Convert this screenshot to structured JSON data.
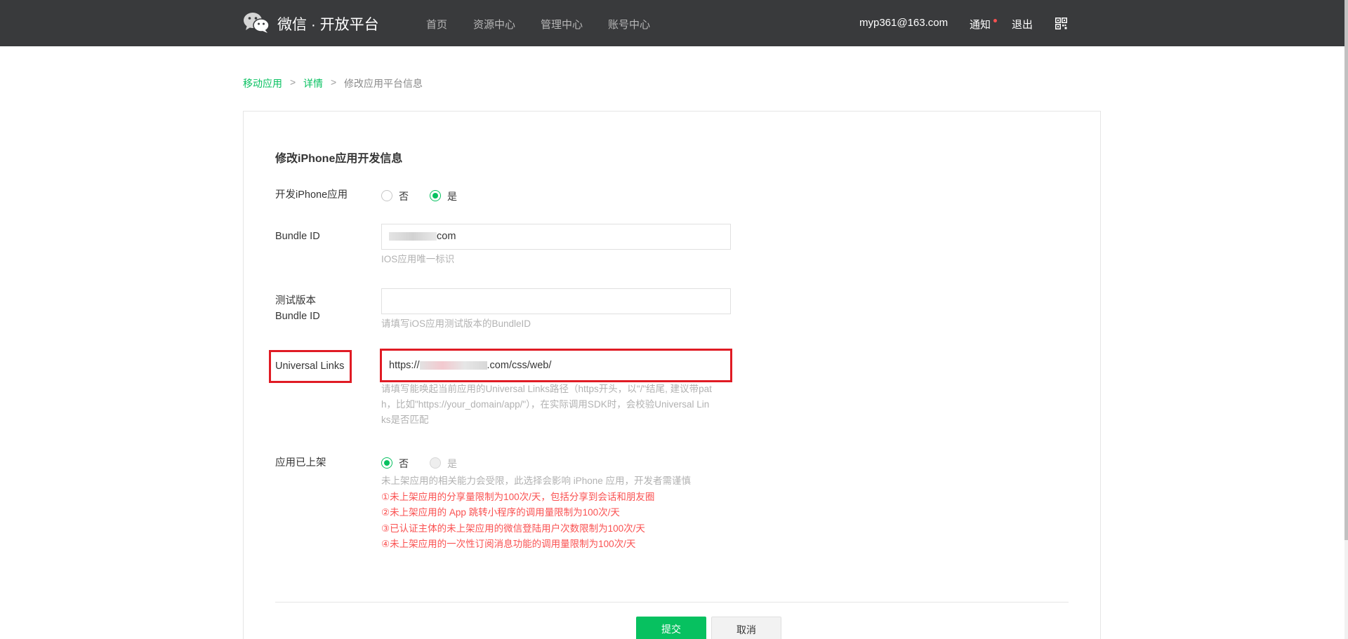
{
  "header": {
    "brand": "微信 · 开放平台",
    "nav": [
      "首页",
      "资源中心",
      "管理中心",
      "账号中心"
    ],
    "user_email": "myp361@163.com",
    "notice_label": "通知",
    "logout_label": "退出",
    "logo_icon": "wechat-logo-icon",
    "qr_icon": "qrcode-icon"
  },
  "breadcrumb": {
    "items": [
      "移动应用",
      "详情",
      "修改应用平台信息"
    ],
    "separator": ">"
  },
  "form": {
    "title": "修改iPhone应用开发信息",
    "develop_iphone": {
      "label": "开发iPhone应用",
      "options": [
        "否",
        "是"
      ],
      "selected": "是"
    },
    "bundle_id": {
      "label": "Bundle ID",
      "value_suffix": "com",
      "hint": "IOS应用唯一标识"
    },
    "test_bundle_id": {
      "label_line1": "测试版本",
      "label_line2": "Bundle ID",
      "value": "",
      "hint": "请填写iOS应用测试版本的BundleID"
    },
    "universal_links": {
      "label": "Universal Links",
      "value_prefix": "https://",
      "value_suffix": ".com/css/web/",
      "hint_lines": [
        "请填写能唤起当前应用的Universal Links路径（https开头，以\"/\"结尾, 建议带pat",
        "h，比如\"https://your_domain/app/\"），在实际调用SDK时，会校验Universal Lin",
        "ks是否匹配"
      ]
    },
    "app_released": {
      "label": "应用已上架",
      "options": [
        "否",
        "是"
      ],
      "selected": "否",
      "note": "未上架应用的相关能力会受限，此选择会影响 iPhone 应用，开发者需谨慎",
      "warnings": [
        "①未上架应用的分享量限制为100次/天，包括分享到会话和朋友圈",
        "②未上架应用的 App 跳转小程序的调用量限制为100次/天",
        "③已认证主体的未上架应用的微信登陆用户次数限制为100次/天",
        "④未上架应用的一次性订阅消息功能的调用量限制为100次/天"
      ]
    },
    "submit_label": "提交",
    "cancel_label": "取消"
  },
  "colors": {
    "header_bg": "#393a3c",
    "accent": "#07c160",
    "warning": "#fa5151",
    "highlight": "#e01b24"
  }
}
